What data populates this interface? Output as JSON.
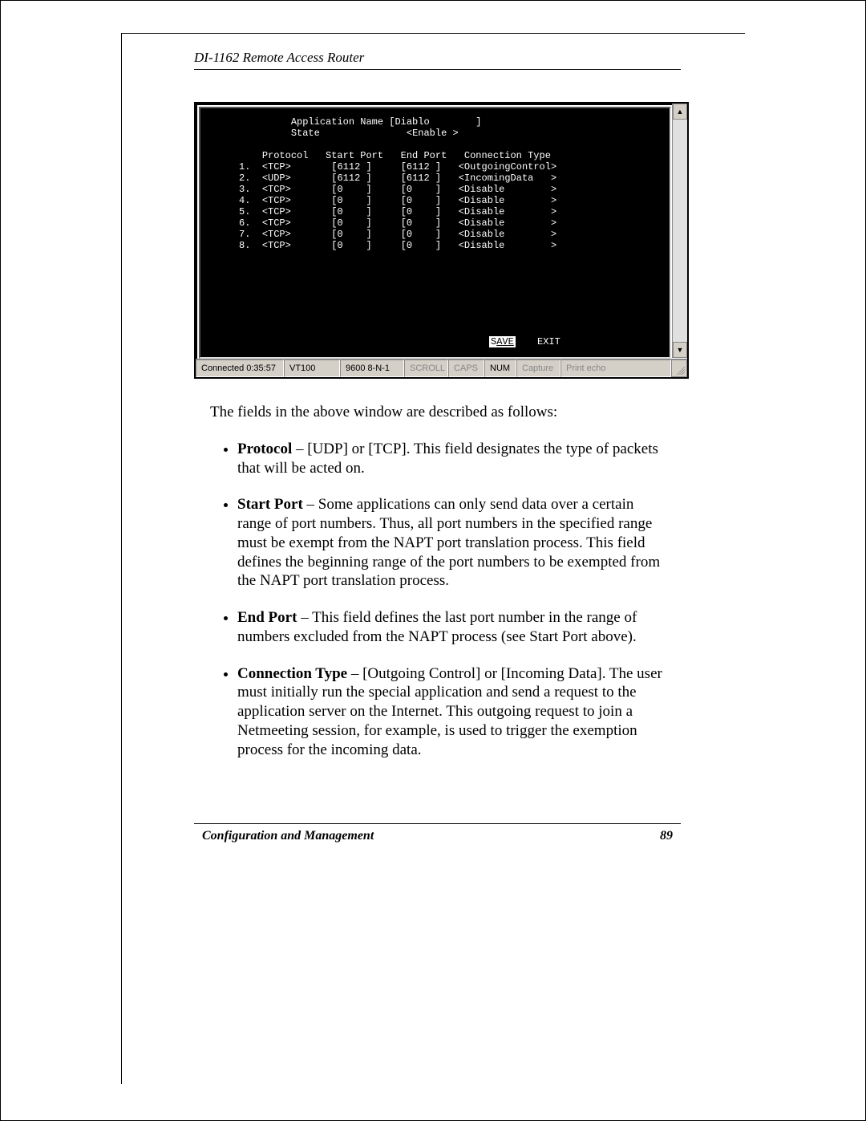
{
  "header": {
    "doc_title": "DI-1162 Remote Access Router"
  },
  "terminal": {
    "app_name_label": "Application Name",
    "app_name_value": "[Diablo        ]",
    "state_label": "State",
    "state_value": "<Enable >",
    "cols": {
      "protocol": "Protocol",
      "start": "Start Port",
      "end": "End Port",
      "conn": "Connection Type"
    },
    "rows": [
      {
        "n": "1.",
        "proto": "<TCP>",
        "start": "[6112 ]",
        "end": "[6112 ]",
        "conn": "<OutgoingControl>"
      },
      {
        "n": "2.",
        "proto": "<UDP>",
        "start": "[6112 ]",
        "end": "[6112 ]",
        "conn": "<IncomingData   >"
      },
      {
        "n": "3.",
        "proto": "<TCP>",
        "start": "[0    ]",
        "end": "[0    ]",
        "conn": "<Disable        >"
      },
      {
        "n": "4.",
        "proto": "<TCP>",
        "start": "[0    ]",
        "end": "[0    ]",
        "conn": "<Disable        >"
      },
      {
        "n": "5.",
        "proto": "<TCP>",
        "start": "[0    ]",
        "end": "[0    ]",
        "conn": "<Disable        >"
      },
      {
        "n": "6.",
        "proto": "<TCP>",
        "start": "[0    ]",
        "end": "[0    ]",
        "conn": "<Disable        >"
      },
      {
        "n": "7.",
        "proto": "<TCP>",
        "start": "[0    ]",
        "end": "[0    ]",
        "conn": "<Disable        >"
      },
      {
        "n": "8.",
        "proto": "<TCP>",
        "start": "[0    ]",
        "end": "[0    ]",
        "conn": "<Disable        >"
      }
    ],
    "save_prefix": "S",
    "save_rest": "AVE",
    "exit": "EXIT"
  },
  "status": {
    "connected": "Connected 0:35:57",
    "emu": "VT100",
    "line": "9600 8-N-1",
    "scroll": "SCROLL",
    "caps": "CAPS",
    "num": "NUM",
    "capture": "Capture",
    "echo": "Print echo"
  },
  "body": {
    "intro": "The fields in the above window are described as follows:",
    "items": [
      {
        "label": "Protocol",
        "text": " – [UDP] or [TCP]. This field designates the type of packets that will be acted on."
      },
      {
        "label": "Start Port",
        "text": " – Some applications can only send data over a certain range of port numbers. Thus, all port numbers in the specified range must be exempt from the NAPT port translation process. This field defines the beginning range of the port numbers to be exempted from the NAPT port translation process."
      },
      {
        "label": "End Port",
        "text": " – This field defines the last port number in the range of numbers excluded from the NAPT process (see Start Port above)."
      },
      {
        "label": "Connection Type",
        "text": " – [Outgoing Control] or [Incoming Data]. The user must initially run the special application and send a request to the application server on the Internet. This outgoing request to join a Netmeeting session, for example, is used to trigger the exemption process for the incoming data."
      }
    ]
  },
  "footer": {
    "section": "Configuration and Management",
    "page": "89"
  }
}
